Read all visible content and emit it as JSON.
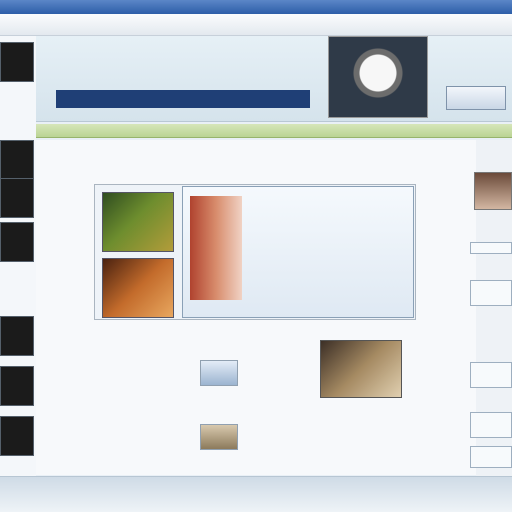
{
  "window": {
    "title": ""
  },
  "header": {
    "title": "",
    "subtitle": "",
    "banner": "",
    "badge": ""
  },
  "nav": {
    "items": [
      "",
      "",
      "",
      "",
      ""
    ]
  },
  "main": {
    "headline": "",
    "subline": "",
    "feature": {
      "title": "",
      "lines": [
        "",
        "",
        "",
        "",
        "",
        "",
        ""
      ]
    },
    "list": [
      "",
      ""
    ],
    "mini_labels": [
      "",
      ""
    ]
  },
  "rail": {
    "items": [
      "",
      "",
      "",
      "",
      ""
    ]
  },
  "footer": {
    "text": ""
  },
  "colors": {
    "titlebar": "#2d5ea8",
    "banner": "#1f3f76",
    "navstrip": "#bad494"
  }
}
